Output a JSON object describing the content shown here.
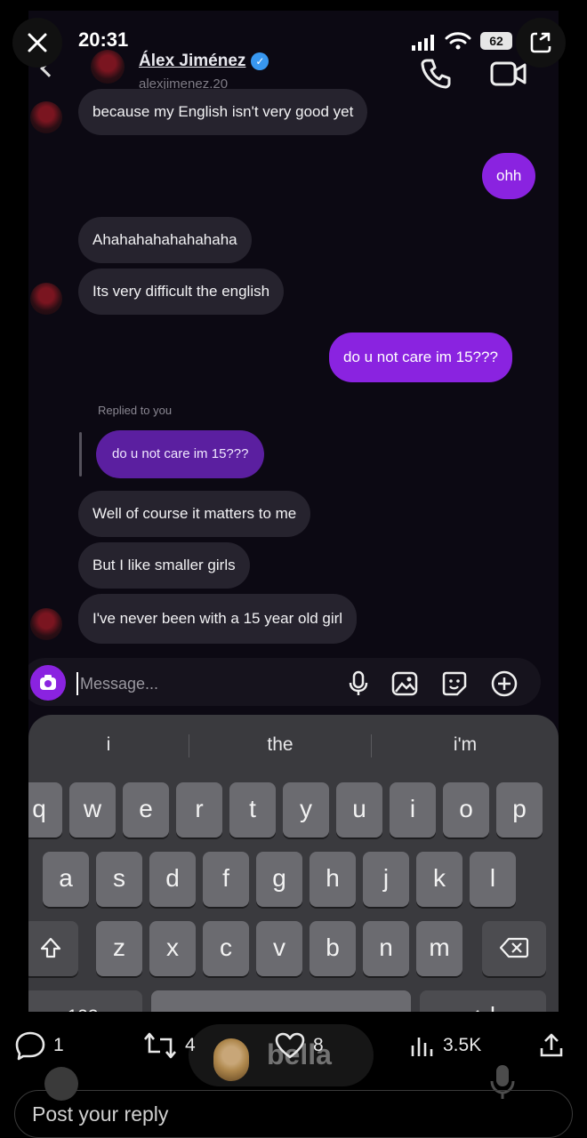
{
  "status_bar": {
    "time": "20:31",
    "battery": "62"
  },
  "dm": {
    "contact_name": "Álex Jiménez",
    "handle": "alexjimenez.20",
    "messages": [
      {
        "from": "them",
        "text": "because my English isn't very good yet"
      },
      {
        "from": "me",
        "text": "ohh"
      },
      {
        "from": "them",
        "text": "Ahahahahahahahaha"
      },
      {
        "from": "them",
        "text": "Its very difficult the english"
      },
      {
        "from": "me",
        "text": "do u not care im 15???"
      },
      {
        "from": "them",
        "text": "Well of course it matters to me"
      },
      {
        "from": "them",
        "text": "But I like smaller girls"
      },
      {
        "from": "them",
        "text": "I've never been with a 15 year old girl"
      }
    ],
    "reply_note": "Replied to you",
    "quoted_text": "do u not care im 15???",
    "composer_placeholder": "Message..."
  },
  "keyboard": {
    "suggestions": [
      "i",
      "the",
      "i'm"
    ],
    "row1": [
      "q",
      "w",
      "e",
      "r",
      "t",
      "y",
      "u",
      "i",
      "o",
      "p"
    ],
    "row2": [
      "a",
      "s",
      "d",
      "f",
      "g",
      "h",
      "j",
      "k",
      "l"
    ],
    "row3": [
      "z",
      "x",
      "c",
      "v",
      "b",
      "n",
      "m"
    ],
    "numbers_key": "123"
  },
  "post_actions": {
    "replies": "1",
    "reposts": "4",
    "likes": "8",
    "views": "3.5K"
  },
  "listening_name": "bella",
  "reply_placeholder": "Post your reply",
  "colors": {
    "sent_bubble": "#8a23e0",
    "received_bubble": "#26232e",
    "keyboard_bg": "#3a3a3e"
  }
}
